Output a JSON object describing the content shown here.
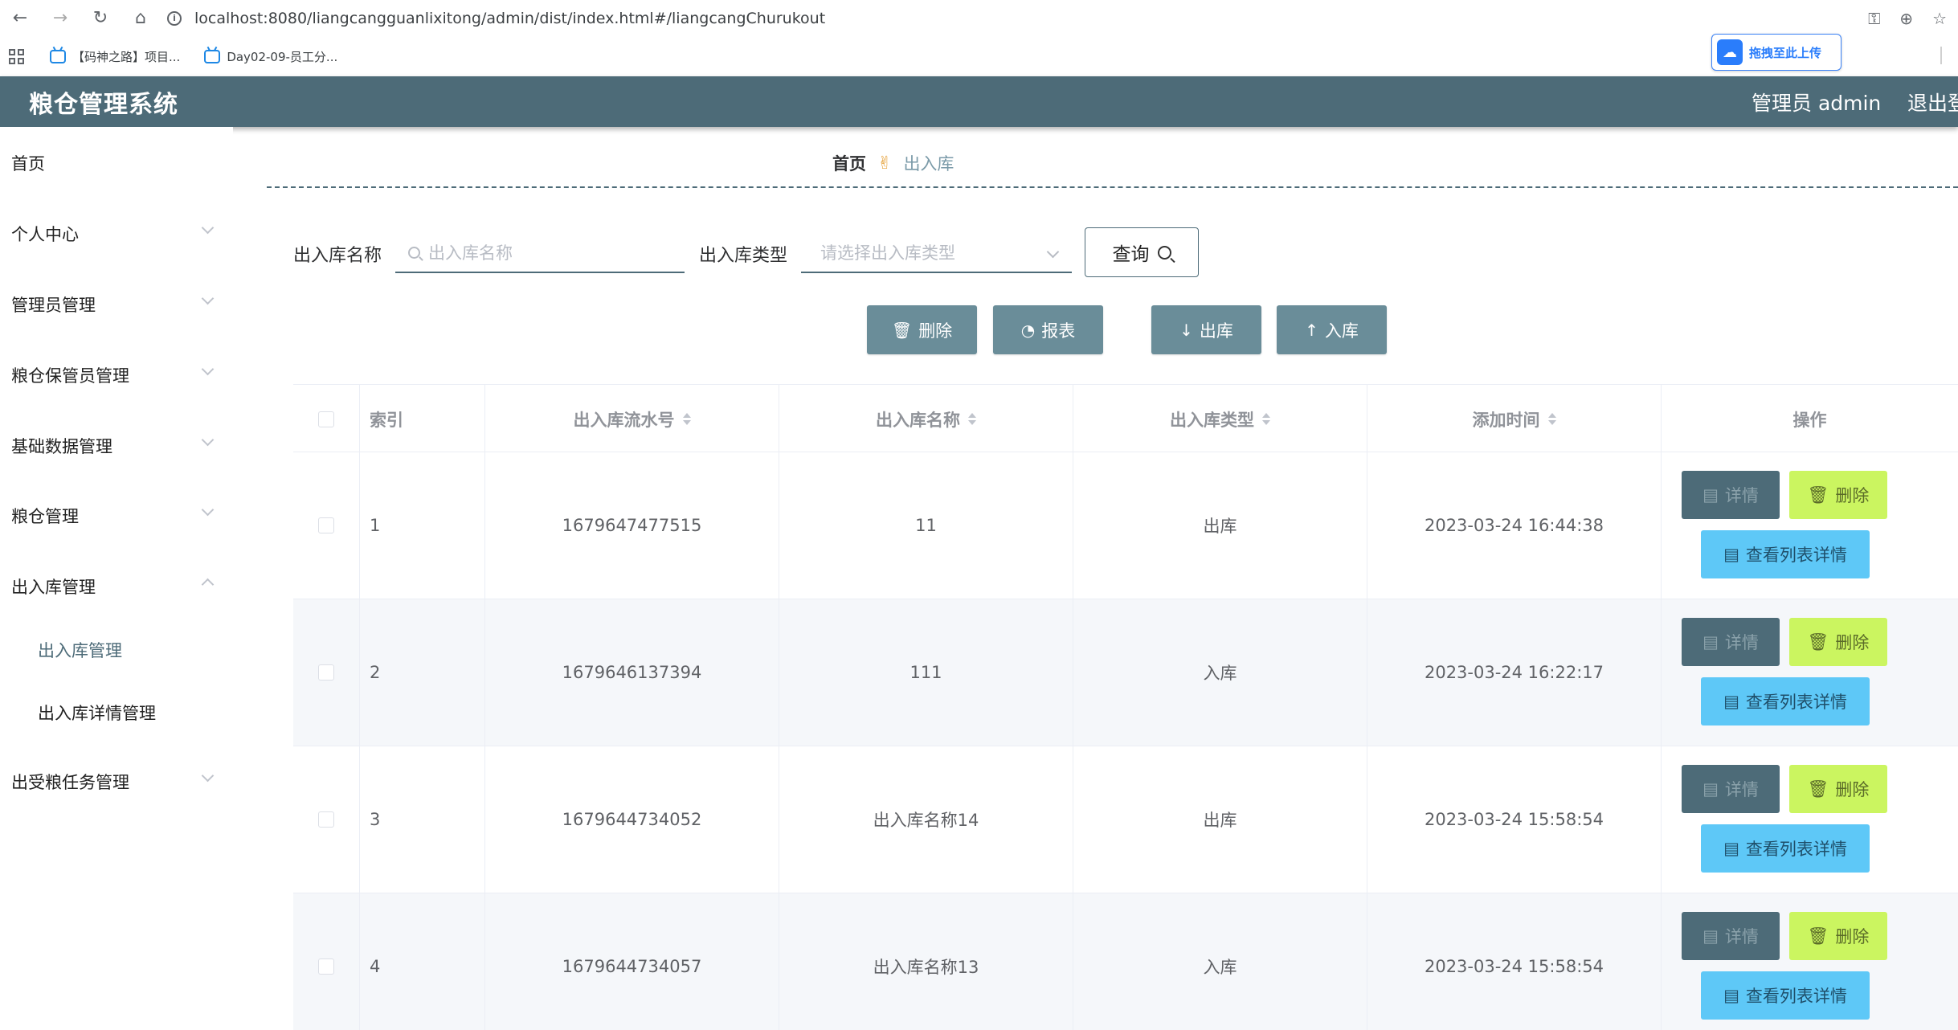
{
  "browser": {
    "url": "localhost:8080/liangcangguanlixitong/admin/dist/index.html#/liangcangChurukout",
    "bookmarks": [
      "【码神之路】项目...",
      "Day02-09-员工分..."
    ],
    "upload_button": "拖拽至此上传"
  },
  "header": {
    "title": "粮仓管理系统",
    "admin_label": "管理员 admin",
    "logout": "退出登录"
  },
  "sidebar": {
    "items": [
      {
        "label": "首页"
      },
      {
        "label": "个人中心"
      },
      {
        "label": "管理员管理"
      },
      {
        "label": "粮仓保管员管理"
      },
      {
        "label": "基础数据管理"
      },
      {
        "label": "粮仓管理"
      },
      {
        "label": "出入库管理"
      },
      {
        "label": "出受粮任务管理"
      }
    ],
    "subitems": [
      {
        "label": "出入库管理"
      },
      {
        "label": "出入库详情管理"
      }
    ]
  },
  "breadcrumb": {
    "home": "首页",
    "current": "出入库"
  },
  "search": {
    "name_label": "出入库名称",
    "name_placeholder": "出入库名称",
    "type_label": "出入库类型",
    "type_placeholder": "请选择出入库类型",
    "query_button": "查询"
  },
  "actions": {
    "delete": "删除",
    "report": "报表",
    "out": "出库",
    "in": "入库"
  },
  "table": {
    "headers": [
      "索引",
      "出入库流水号",
      "出入库名称",
      "出入库类型",
      "添加时间",
      "操作"
    ],
    "rows": [
      {
        "index": "1",
        "serial": "1679647477515",
        "name": "11",
        "type": "出库",
        "time": "2023-03-24 16:44:38"
      },
      {
        "index": "2",
        "serial": "1679646137394",
        "name": "111",
        "type": "入库",
        "time": "2023-03-24 16:22:17"
      },
      {
        "index": "3",
        "serial": "1679644734052",
        "name": "出入库名称14",
        "type": "出库",
        "time": "2023-03-24 15:58:54"
      },
      {
        "index": "4",
        "serial": "1679644734057",
        "name": "出入库名称13",
        "type": "入库",
        "time": "2023-03-24 15:58:54"
      }
    ],
    "op_detail": "详情",
    "op_delete": "删除",
    "op_list_detail": "查看列表详情"
  },
  "colors": {
    "header_bg": "#4d6b78",
    "action_btn": "#6a8d99",
    "detail_btn": "#4d6b78",
    "delete_btn": "#cbf560",
    "list_btn": "#5ec8f7"
  }
}
